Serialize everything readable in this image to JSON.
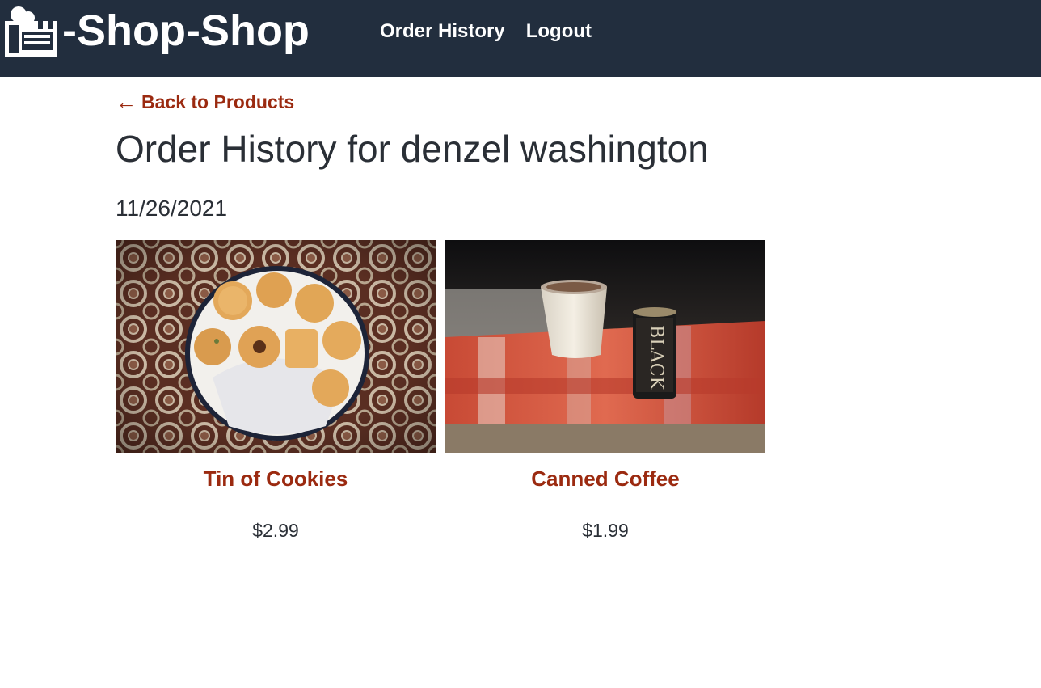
{
  "header": {
    "brand_text": "-Shop-Shop",
    "brand_icon": "shop-icon",
    "nav": [
      {
        "label": "Order History"
      },
      {
        "label": "Logout"
      }
    ],
    "background": "#222e3e"
  },
  "main": {
    "back_link": {
      "arrow": "←",
      "label": "Back to Products"
    },
    "title": "Order History for denzel washington",
    "orders": [
      {
        "date": "11/26/2021",
        "products": [
          {
            "name": "Tin of Cookies",
            "price": "$2.99",
            "image_alt": "cookie-tin-photo"
          },
          {
            "name": "Canned Coffee",
            "price": "$1.99",
            "image_alt": "canned-coffee-photo"
          }
        ]
      }
    ]
  },
  "colors": {
    "accent": "#9b2a10",
    "text": "#2a2f36",
    "header_bg": "#222e3e"
  }
}
